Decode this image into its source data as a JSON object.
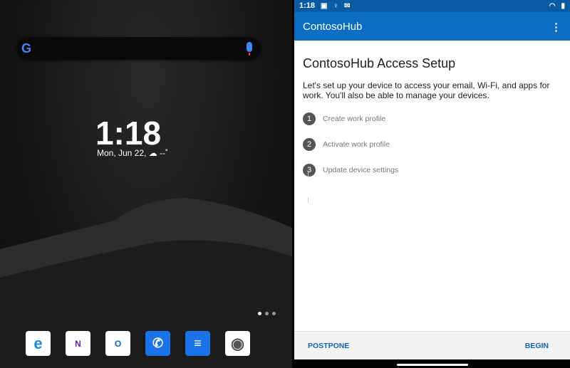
{
  "home": {
    "clock": "1:18",
    "date": "Mon, Jun 22,",
    "weather": "☁ --˚",
    "dock": [
      {
        "name": "edge",
        "glyph": "e",
        "color": "#1b8ad6"
      },
      {
        "name": "onenote",
        "glyph": "N",
        "color": "#7719aa"
      },
      {
        "name": "outlook",
        "glyph": "O",
        "color": "#0a64c6"
      },
      {
        "name": "phone",
        "glyph": "✆",
        "color": "#fff"
      },
      {
        "name": "messages",
        "glyph": "≡",
        "color": "#fff"
      },
      {
        "name": "camera",
        "glyph": "◉",
        "color": "#6b6cf0"
      }
    ]
  },
  "status": {
    "time": "1:18"
  },
  "app": {
    "title": "ContosoHub",
    "menu": "⋮",
    "heading": "ContosoHub Access Setup",
    "description": "Let's set up your device to access your email, Wi-Fi, and apps for work. You'll also be able to manage your devices.",
    "steps": [
      {
        "num": "1",
        "label": "Create work profile"
      },
      {
        "num": "2",
        "label": "Activate work profile"
      },
      {
        "num": "3",
        "label": "Update device settings"
      }
    ],
    "postpone": "POSTPONE",
    "begin": "BEGIN"
  }
}
